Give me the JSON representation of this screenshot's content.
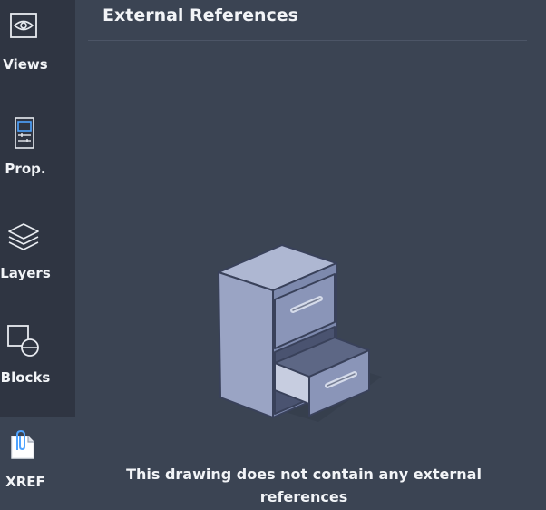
{
  "sidebar": {
    "items": [
      {
        "label": "Views",
        "icon": "eye-icon",
        "active": false
      },
      {
        "label": "Prop.",
        "icon": "properties-icon",
        "active": false
      },
      {
        "label": "Layers",
        "icon": "layers-icon",
        "active": false
      },
      {
        "label": "Blocks",
        "icon": "blocks-icon",
        "active": false
      },
      {
        "label": "XREF",
        "icon": "xref-icon",
        "active": true
      }
    ]
  },
  "panel": {
    "title": "External References",
    "empty_message": "This drawing does not contain any external references",
    "empty_icon": "filing-cabinet-icon"
  },
  "colors": {
    "panel_bg": "#3b4453",
    "sidebar_bg": "#2f3542",
    "text": "#f2f4f7",
    "accent": "#4ea3ff",
    "cabinet": "#8e99b8"
  }
}
